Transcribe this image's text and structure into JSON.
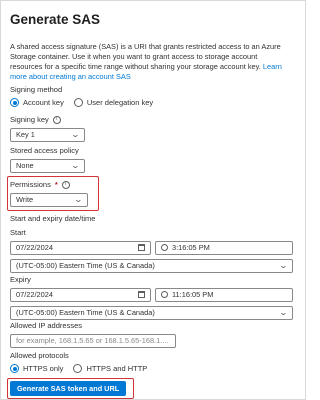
{
  "panel": {
    "title": "Generate SAS",
    "description": "A shared access signature (SAS) is a URI that grants restricted access to an Azure Storage container. Use it when you want to grant access to storage account resources for a specific time range without sharing your storage account key.",
    "learn_more_link": "Learn more about creating an account SAS"
  },
  "signing_method": {
    "label": "Signing method",
    "options": [
      "Account key",
      "User delegation key"
    ],
    "selected": "Account key"
  },
  "signing_key": {
    "label": "Signing key",
    "value": "Key 1"
  },
  "stored_access_policy": {
    "label": "Stored access policy",
    "value": "None"
  },
  "permissions": {
    "label": "Permissions",
    "required_marker": "*",
    "value": "Write"
  },
  "start_expiry": {
    "label": "Start and expiry date/time"
  },
  "start": {
    "label": "Start",
    "date": "07/22/2024",
    "time": "3:16:05 PM",
    "timezone": "(UTC-05:00) Eastern Time (US & Canada)"
  },
  "expiry": {
    "label": "Expiry",
    "date": "07/22/2024",
    "time": "11:16:05 PM",
    "timezone": "(UTC-05:00) Eastern Time (US & Canada)"
  },
  "allowed_ip": {
    "label": "Allowed IP addresses",
    "placeholder": "for example, 168.1.5.65 or 168.1.5.65-168.1...."
  },
  "allowed_protocols": {
    "label": "Allowed protocols",
    "options": [
      "HTTPS only",
      "HTTPS and HTTP"
    ],
    "selected": "HTTPS only"
  },
  "generate_button": {
    "label": "Generate SAS token and URL"
  },
  "colors": {
    "accent": "#0078d4",
    "highlight": "#d13438",
    "required": "#a4262c"
  },
  "icons": {
    "info": "info-icon",
    "dropdown": "chevron-down-icon",
    "calendar": "calendar-icon",
    "clock": "clock-icon"
  }
}
